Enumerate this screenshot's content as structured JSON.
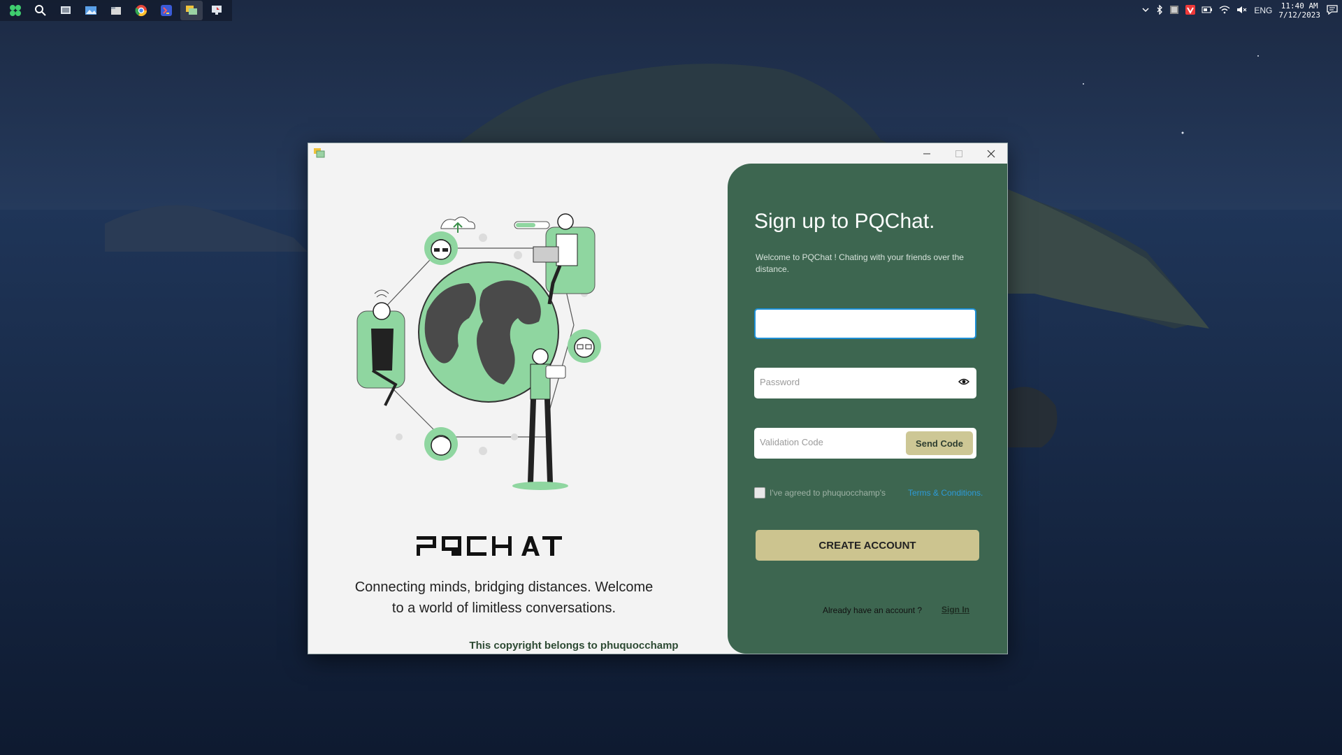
{
  "taskbar": {
    "apps": [
      "start-icon",
      "search-icon",
      "task-view-icon",
      "photos-icon",
      "file-explorer-icon",
      "chrome-icon",
      "visual-studio-icon",
      "pqchat-icon",
      "remote-desktop-icon"
    ],
    "tray": {
      "lang": "ENG",
      "time": "11:40 AM",
      "date": "7/12/2023"
    }
  },
  "window": {
    "left": {
      "brand": "PQCHAT",
      "tagline": "Connecting minds, bridging distances. Welcome to a world of limitless conversations.",
      "copyright": "This copyright belongs to phuquocchamp"
    },
    "form": {
      "title": "Sign up to PQChat.",
      "subtitle": "Welcome to PQChat ! Chating with your friends over the distance.",
      "email_value": "",
      "password_placeholder": "Password",
      "code_placeholder": "Validation Code",
      "send_code": "Send Code",
      "agree_text": "I've agreed to phuquocchamp's",
      "terms_link": "Terms & Conditions.",
      "create_button": "CREATE ACCOUNT",
      "have_account": "Already have an account ?",
      "sign_in": "Sign In"
    }
  },
  "colors": {
    "panel": "#3d6650",
    "accent_button": "#ccc48f",
    "illustration_green": "#8fd6a0"
  }
}
